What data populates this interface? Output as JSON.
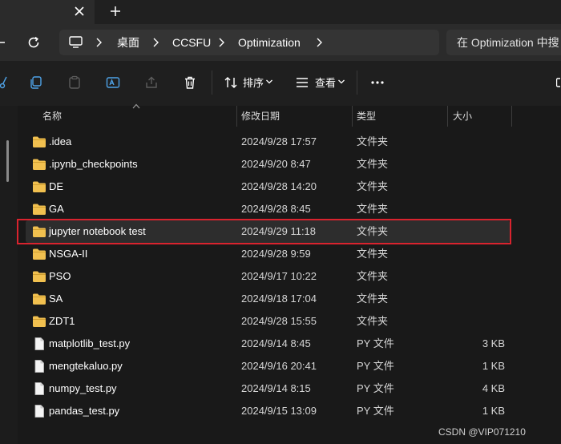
{
  "tabs": {
    "close_icon": "close-icon",
    "new_tab_icon": "plus-icon"
  },
  "address": {
    "breadcrumbs": [
      "桌面",
      "CCSFU",
      "Optimization"
    ],
    "search_placeholder": "在 Optimization 中搜"
  },
  "toolbar": {
    "sort_label": "排序",
    "view_label": "查看"
  },
  "columns": {
    "name": "名称",
    "modified": "修改日期",
    "type": "类型",
    "size": "大小"
  },
  "files": [
    {
      "name": ".idea",
      "modified": "2024/9/28 17:57",
      "type": "文件夹",
      "size": "",
      "kind": "folder"
    },
    {
      "name": ".ipynb_checkpoints",
      "modified": "2024/9/20 8:47",
      "type": "文件夹",
      "size": "",
      "kind": "folder"
    },
    {
      "name": "DE",
      "modified": "2024/9/28 14:20",
      "type": "文件夹",
      "size": "",
      "kind": "folder"
    },
    {
      "name": "GA",
      "modified": "2024/9/28 8:45",
      "type": "文件夹",
      "size": "",
      "kind": "folder"
    },
    {
      "name": "jupyter notebook test",
      "modified": "2024/9/29 11:18",
      "type": "文件夹",
      "size": "",
      "kind": "folder",
      "selected": true
    },
    {
      "name": "NSGA-II",
      "modified": "2024/9/28 9:59",
      "type": "文件夹",
      "size": "",
      "kind": "folder"
    },
    {
      "name": "PSO",
      "modified": "2024/9/17 10:22",
      "type": "文件夹",
      "size": "",
      "kind": "folder"
    },
    {
      "name": "SA",
      "modified": "2024/9/18 17:04",
      "type": "文件夹",
      "size": "",
      "kind": "folder"
    },
    {
      "name": "ZDT1",
      "modified": "2024/9/28 15:55",
      "type": "文件夹",
      "size": "",
      "kind": "folder"
    },
    {
      "name": "matplotlib_test.py",
      "modified": "2024/9/14 8:45",
      "type": "PY 文件",
      "size": "3 KB",
      "kind": "file"
    },
    {
      "name": "mengtekaluo.py",
      "modified": "2024/9/16 20:41",
      "type": "PY 文件",
      "size": "1 KB",
      "kind": "file"
    },
    {
      "name": "numpy_test.py",
      "modified": "2024/9/14 8:15",
      "type": "PY 文件",
      "size": "4 KB",
      "kind": "file"
    },
    {
      "name": "pandas_test.py",
      "modified": "2024/9/15 13:09",
      "type": "PY 文件",
      "size": "1 KB",
      "kind": "file"
    }
  ],
  "watermark": "CSDN @VIP071210",
  "colors": {
    "folder": "#f1c04f",
    "highlight": "#d9232e",
    "selected_row": "#2d2d2d"
  }
}
